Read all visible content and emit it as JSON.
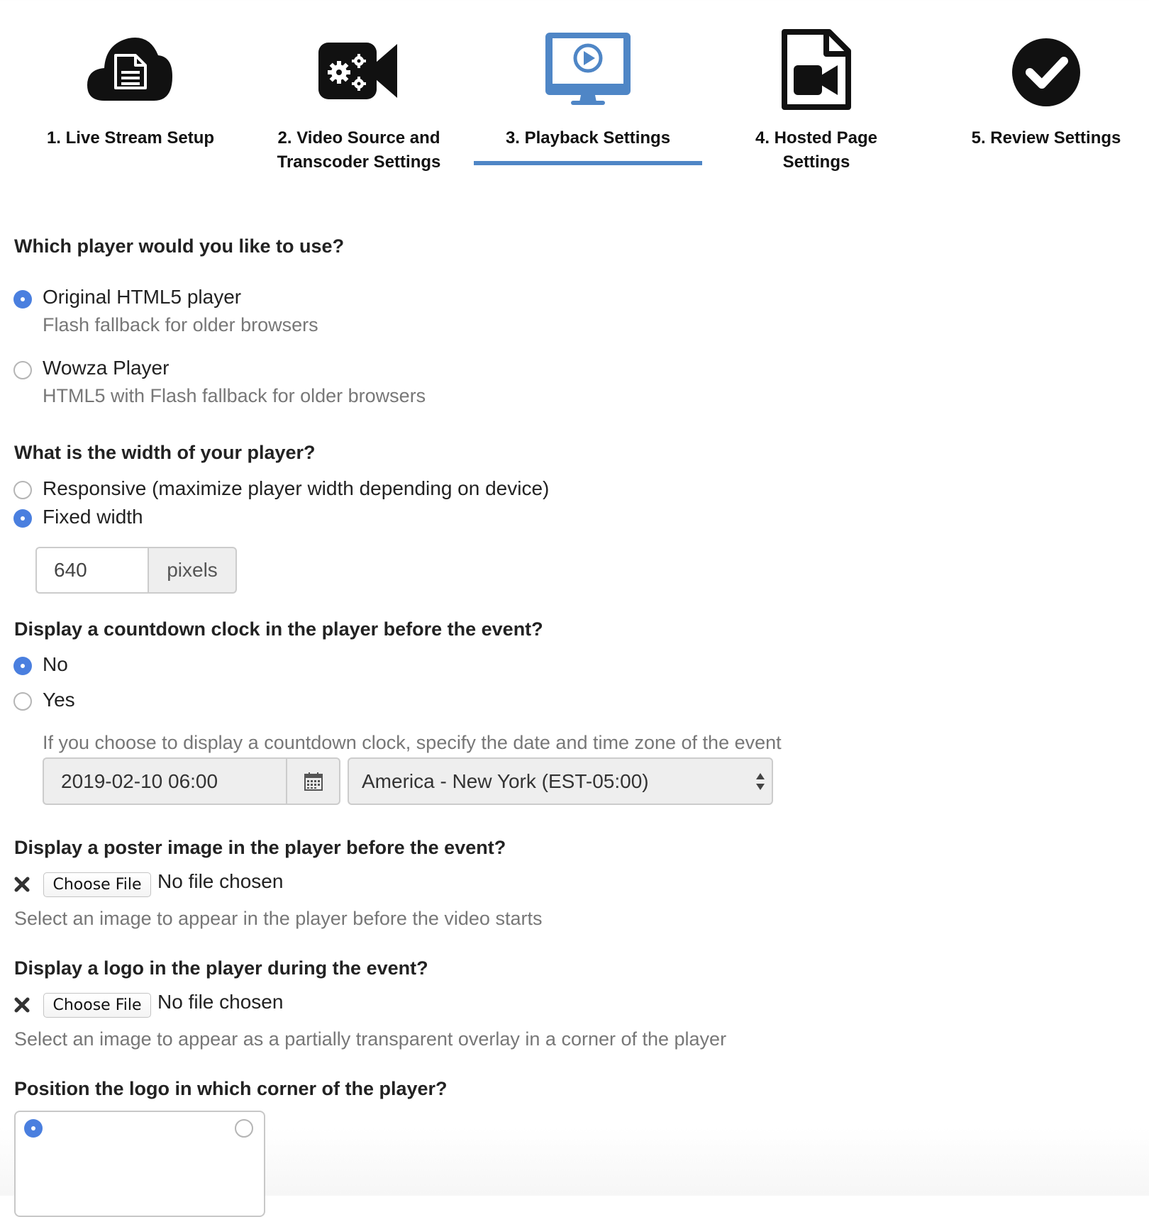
{
  "steps": [
    {
      "label": "1. Live Stream Setup",
      "icon": "cloud-document-icon"
    },
    {
      "label": "2. Video Source and Transcoder Settings",
      "icon": "video-camera-gears-icon"
    },
    {
      "label": "3. Playback Settings",
      "icon": "monitor-play-icon",
      "active": true
    },
    {
      "label": "4. Hosted Page Settings",
      "icon": "file-video-icon"
    },
    {
      "label": "5. Review Settings",
      "icon": "check-circle-icon"
    }
  ],
  "player": {
    "question": "Which player would you like to use?",
    "options": [
      {
        "label": "Original HTML5 player",
        "help": "Flash fallback for older browsers",
        "checked": true
      },
      {
        "label": "Wowza Player",
        "help": "HTML5 with Flash fallback for older browsers",
        "checked": false
      }
    ]
  },
  "width": {
    "question": "What is the width of your player?",
    "options": [
      {
        "label": "Responsive (maximize player width depending on device)",
        "checked": false
      },
      {
        "label": "Fixed width",
        "checked": true
      }
    ],
    "value": "640",
    "unit": "pixels"
  },
  "countdown": {
    "question": "Display a countdown clock in the player before the event?",
    "options": [
      {
        "label": "No",
        "checked": true
      },
      {
        "label": "Yes",
        "checked": false
      }
    ],
    "help": "If you choose to display a countdown clock, specify the date and time zone of the event",
    "datetime": "2019-02-10 06:00",
    "timezone": "America - New York (EST-05:00)"
  },
  "poster": {
    "question": "Display a poster image in the player before the event?",
    "button": "Choose File",
    "status": "No file chosen",
    "help": "Select an image to appear in the player before the video starts"
  },
  "logo": {
    "question": "Display a logo in the player during the event?",
    "button": "Choose File",
    "status": "No file chosen",
    "help": "Select an image to appear as a partially transparent overlay in a corner of the player"
  },
  "logo_position": {
    "question": "Position the logo in which corner of the player?",
    "selected": "top-left"
  },
  "colors": {
    "accent": "#4f86c6",
    "radio_checked": "#4a7fdf"
  }
}
